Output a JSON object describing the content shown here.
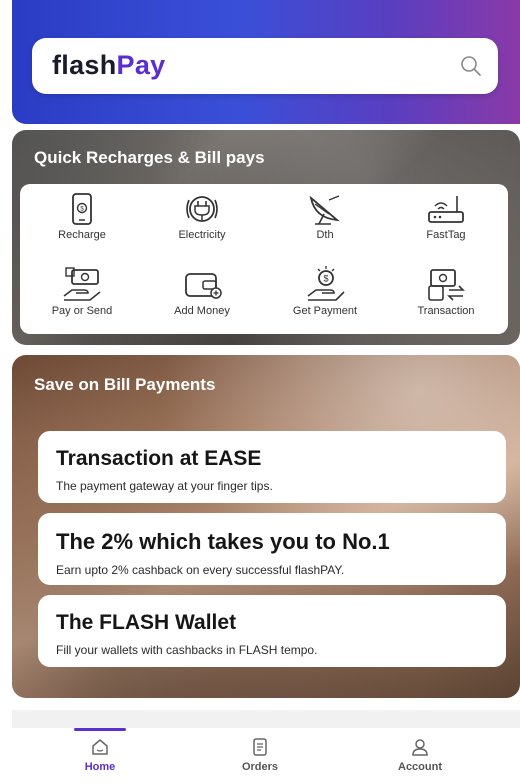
{
  "header": {
    "brand_part1": "flash",
    "brand_part2": "Pay",
    "search_icon": "search-icon"
  },
  "quick": {
    "title": "Quick Recharges & Bill pays",
    "items": [
      {
        "label": "Recharge",
        "icon": "mobile-recharge-icon"
      },
      {
        "label": "Electricity",
        "icon": "electricity-plug-icon"
      },
      {
        "label": "Dth",
        "icon": "satellite-dish-icon"
      },
      {
        "label": "FastTag",
        "icon": "router-tag-icon"
      },
      {
        "label": "Pay or Send",
        "icon": "hand-cash-icon"
      },
      {
        "label": "Add Money",
        "icon": "wallet-add-icon"
      },
      {
        "label": "Get Payment",
        "icon": "receive-coin-icon"
      },
      {
        "label": "Transaction",
        "icon": "transaction-exchange-icon"
      }
    ]
  },
  "save": {
    "title": "Save on Bill Payments",
    "promos": [
      {
        "title": "Transaction at EASE",
        "subtitle": "The payment gateway at your finger tips."
      },
      {
        "title": "The 2% which takes you to No.1",
        "subtitle": "Earn upto 2% cashback on every successful flashPAY."
      },
      {
        "title": "The FLASH Wallet",
        "subtitle": "Fill your wallets with cashbacks in FLASH tempo."
      }
    ]
  },
  "nav": {
    "items": [
      {
        "label": "Home",
        "icon": "home-icon",
        "active": true
      },
      {
        "label": "Orders",
        "icon": "orders-icon",
        "active": false
      },
      {
        "label": "Account",
        "icon": "account-icon",
        "active": false
      }
    ]
  },
  "colors": {
    "brand_purple": "#5b2ecf",
    "header_blue": "#2b3cc4"
  }
}
